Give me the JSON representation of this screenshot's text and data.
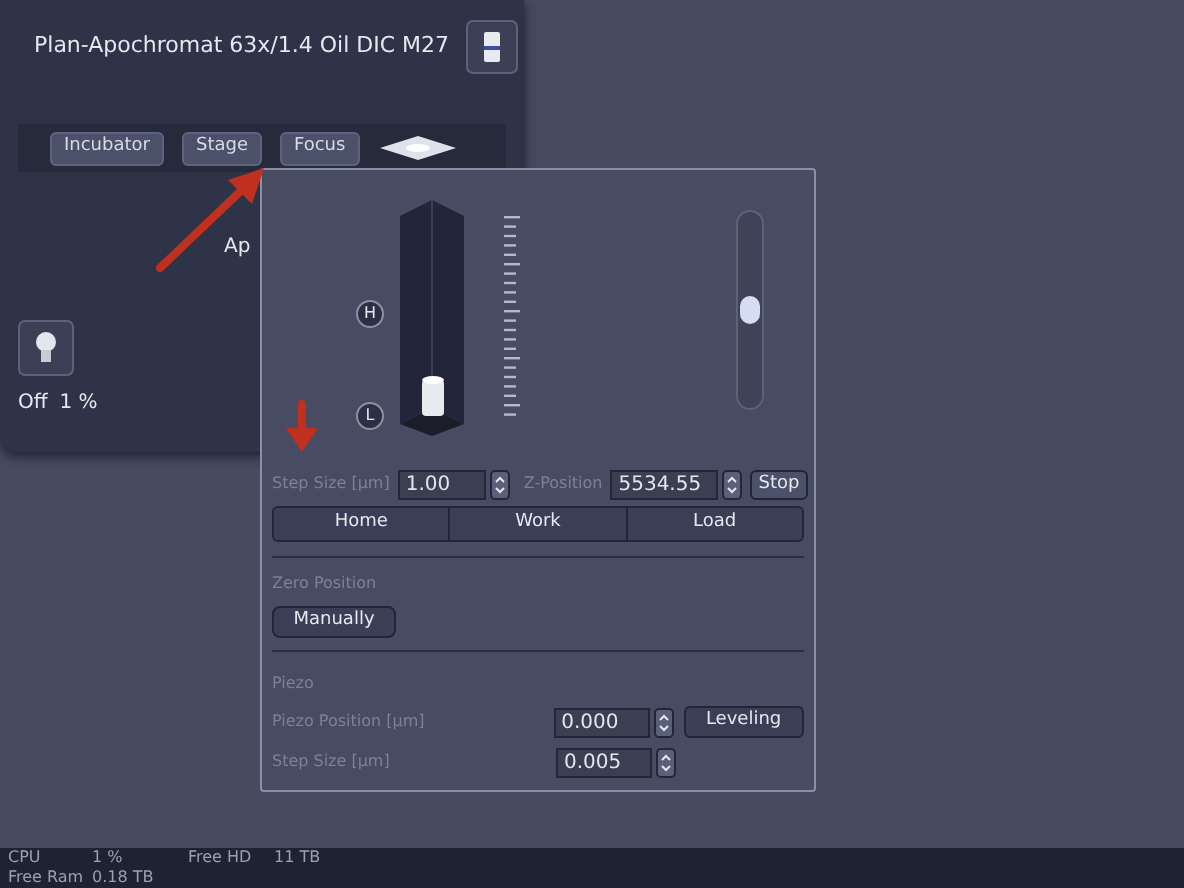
{
  "objective": {
    "name": "Plan-Apochromat 63x/1.4 Oil DIC M27"
  },
  "toolbar": {
    "buttons": [
      "Incubator",
      "Stage",
      "Focus"
    ]
  },
  "partial_label": "Ap",
  "lamp": {
    "status": "Off",
    "value": "1 %"
  },
  "focus_panel": {
    "height_buttons": [
      "H",
      "L"
    ],
    "slider": {
      "level": 0.5
    },
    "step_size": {
      "label": "Step Size [µm]",
      "value": "1.00"
    },
    "z_position": {
      "label": "Z-Position",
      "value": "5534.55"
    },
    "stop": "Stop",
    "positions": [
      "Home",
      "Work",
      "Load"
    ],
    "zero_position": {
      "title": "Zero Position",
      "button": "Manually"
    },
    "piezo": {
      "title": "Piezo",
      "position": {
        "label": "Piezo Position [µm]",
        "value": "0.000"
      },
      "leveling": "Leveling",
      "step_size": {
        "label": "Step Size [µm]",
        "value": "0.005"
      }
    }
  },
  "status_bar": [
    {
      "label": "CPU",
      "value": "1 %"
    },
    {
      "label": "Free HD",
      "value": "11 TB"
    },
    {
      "label": "Free Ram",
      "value": "0.18 TB"
    }
  ]
}
